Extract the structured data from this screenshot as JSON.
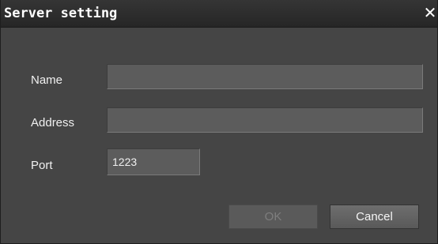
{
  "window": {
    "title": "Server setting",
    "close_glyph": "✕"
  },
  "form": {
    "name_label": "Name",
    "name_value": "",
    "address_label": "Address",
    "address_value": "",
    "port_label": "Port",
    "port_value": "1223"
  },
  "buttons": {
    "ok_label": "OK",
    "ok_enabled": false,
    "cancel_label": "Cancel"
  },
  "colors": {
    "background": "#454545",
    "titlebar": "#262626",
    "field": "#5c5c5c",
    "text": "#f0f0f0"
  }
}
